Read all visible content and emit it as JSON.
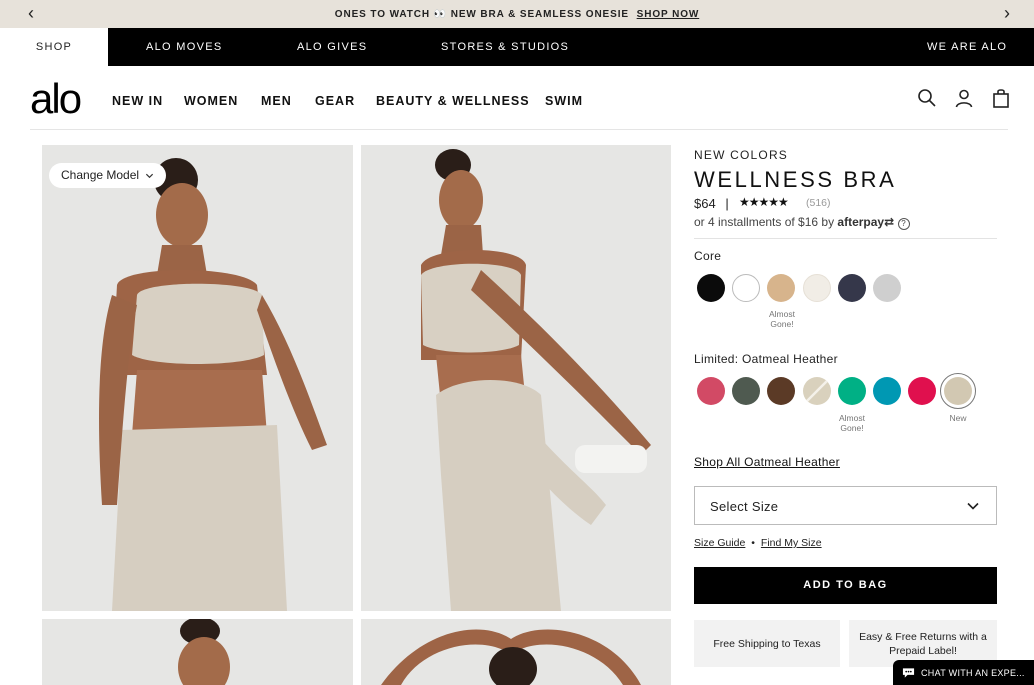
{
  "promo": {
    "left_arrow": "‹",
    "right_arrow": "›",
    "text": "ONES TO WATCH 👀 NEW BRA & SEAMLESS ONESIE",
    "link": "SHOP NOW"
  },
  "topnav": {
    "items": [
      "SHOP",
      "ALO MOVES",
      "ALO GIVES",
      "STORES & STUDIOS",
      "WE ARE ALO"
    ]
  },
  "header": {
    "logo": "alo",
    "nav": [
      "NEW IN",
      "WOMEN",
      "MEN",
      "GEAR",
      "BEAUTY & WELLNESS",
      "SWIM"
    ],
    "icons": [
      "search-icon",
      "account-icon",
      "bag-icon"
    ]
  },
  "gallery": {
    "change_model": "Change Model"
  },
  "product": {
    "eyebrow": "NEW COLORS",
    "title": "WELLNESS BRA",
    "price": "$64",
    "separator": "|",
    "stars": "★★★★★",
    "reviews": "(516)",
    "installments_prefix": "or 4 installments of $16 by",
    "afterpay": "afterpay",
    "afterpay_mark": "⇄",
    "info_icon": "?"
  },
  "colors": {
    "core_label": "Core",
    "core": [
      {
        "color": "#0b0b0b"
      },
      {
        "color": "#ffffff"
      },
      {
        "color": "#d7b48c",
        "note": "Almost Gone!"
      },
      {
        "color": "#f1ede6"
      },
      {
        "color": "#35374a"
      },
      {
        "color": "#cfcfcf"
      }
    ],
    "limited_label": "Limited: Oatmeal Heather",
    "limited": [
      {
        "color": "#d24a65"
      },
      {
        "color": "#4f5a50"
      },
      {
        "color": "#5b3a26"
      },
      {
        "color": "#d9d1bd"
      },
      {
        "color": "#00b085",
        "note": "Almost Gone!"
      },
      {
        "color": "#0098b3"
      },
      {
        "color": "#e0104e"
      },
      {
        "color": "#d2c8b2",
        "note": "New",
        "selected": true
      }
    ]
  },
  "shop_all": "Shop All Oatmeal Heather",
  "size": {
    "select_label": "Select Size",
    "guide": "Size Guide",
    "bullet": "•",
    "find": "Find My Size"
  },
  "add_to_bag": "ADD TO BAG",
  "perks": [
    "Free Shipping to Texas",
    "Easy & Free Returns with a Prepaid Label!"
  ],
  "chat": "CHAT WITH AN EXPE..."
}
